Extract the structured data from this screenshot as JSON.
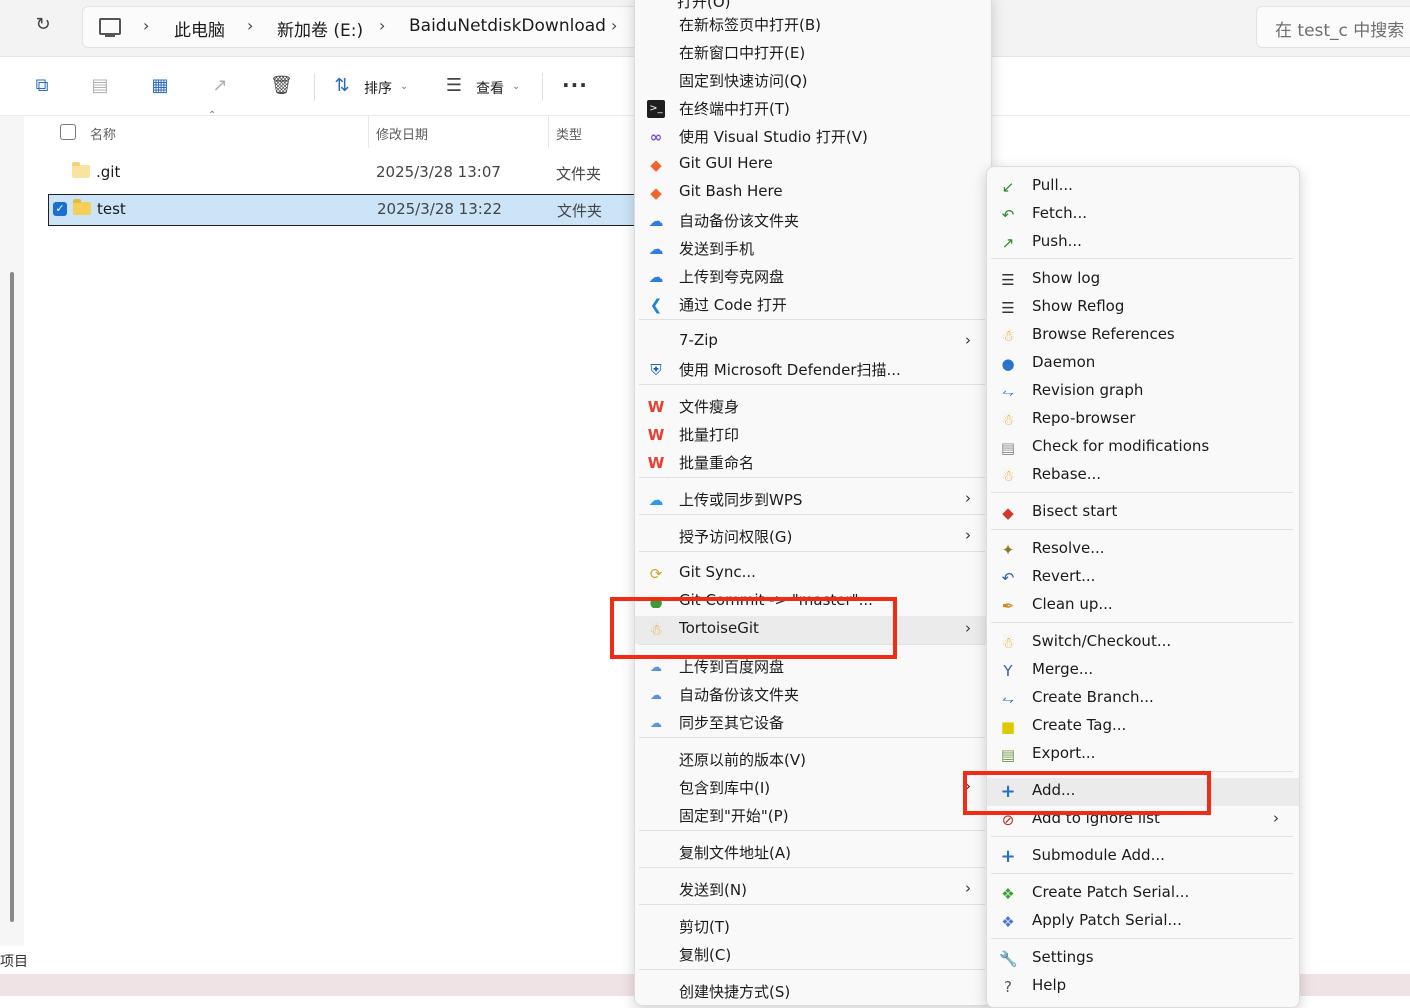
{
  "breadcrumb": {
    "items": [
      "此电脑",
      "新加卷 (E:)",
      "BaiduNetdiskDownload"
    ]
  },
  "search": {
    "placeholder": "在 test_c 中搜索"
  },
  "toolbar": {
    "sort": "排序",
    "view": "查看",
    "more": "···"
  },
  "file_list": {
    "columns": {
      "name": "名称",
      "date": "修改日期",
      "type": "类型"
    },
    "rows": [
      {
        "name": ".git",
        "date": "2025/3/28 13:07",
        "type": "文件夹",
        "selected": false
      },
      {
        "name": "test",
        "date": "2025/3/28 13:22",
        "type": "文件夹",
        "selected": true
      }
    ]
  },
  "status": {
    "text": "项目"
  },
  "context_menu": {
    "partial_top": "打开(O)",
    "items": [
      "在新标签页中打开(B)",
      "在新窗口中打开(E)",
      "固定到快速访问(Q)",
      "在终端中打开(T)",
      "使用 Visual Studio 打开(V)",
      "Git GUI Here",
      "Git Bash Here",
      "自动备份该文件夹",
      "发送到手机",
      "上传到夸克网盘",
      "通过 Code 打开",
      "7-Zip",
      "使用 Microsoft Defender扫描...",
      "文件瘦身",
      "批量打印",
      "批量重命名",
      "上传或同步到WPS",
      "授予访问权限(G)",
      "Git Sync...",
      "Git Commit -> \"master\"...",
      "TortoiseGit",
      "上传到百度网盘",
      "自动备份该文件夹",
      "同步至其它设备",
      "还原以前的版本(V)",
      "包含到库中(I)",
      "固定到\"开始\"(P)",
      "复制文件地址(A)",
      "发送到(N)",
      "剪切(T)",
      "复制(C)",
      "创建快捷方式(S)"
    ]
  },
  "tortoisegit_menu": {
    "items": [
      "Pull...",
      "Fetch...",
      "Push...",
      "Show log",
      "Show Reflog",
      "Browse References",
      "Daemon",
      "Revision graph",
      "Repo-browser",
      "Check for modifications",
      "Rebase...",
      "Bisect start",
      "Resolve...",
      "Revert...",
      "Clean up...",
      "Switch/Checkout...",
      "Merge...",
      "Create Branch...",
      "Create Tag...",
      "Export...",
      "Add...",
      "Add to ignore list",
      "Submodule Add...",
      "Create Patch Serial...",
      "Apply Patch Serial...",
      "Settings",
      "Help"
    ]
  },
  "colors": {
    "highlight_box": "#f22b15",
    "selection": "#cce4f7",
    "accent": "#1b6fd1"
  }
}
